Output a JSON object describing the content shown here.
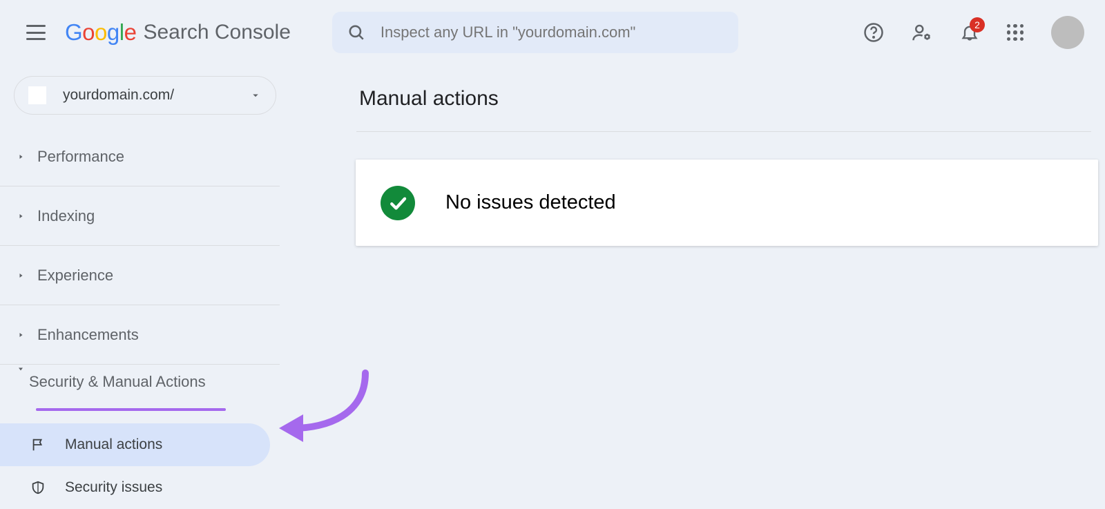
{
  "header": {
    "app_name": "Search Console",
    "search_placeholder": "Inspect any URL in \"yourdomain.com\"",
    "notification_count": "2"
  },
  "sidebar": {
    "property": "yourdomain.com/",
    "sections": {
      "performance": "Performance",
      "indexing": "Indexing",
      "experience": "Experience",
      "enhancements": "Enhancements",
      "security": "Security & Manual Actions"
    },
    "security_children": {
      "manual_actions": "Manual actions",
      "security_issues": "Security issues"
    }
  },
  "main": {
    "title": "Manual actions",
    "status_message": "No issues detected"
  }
}
